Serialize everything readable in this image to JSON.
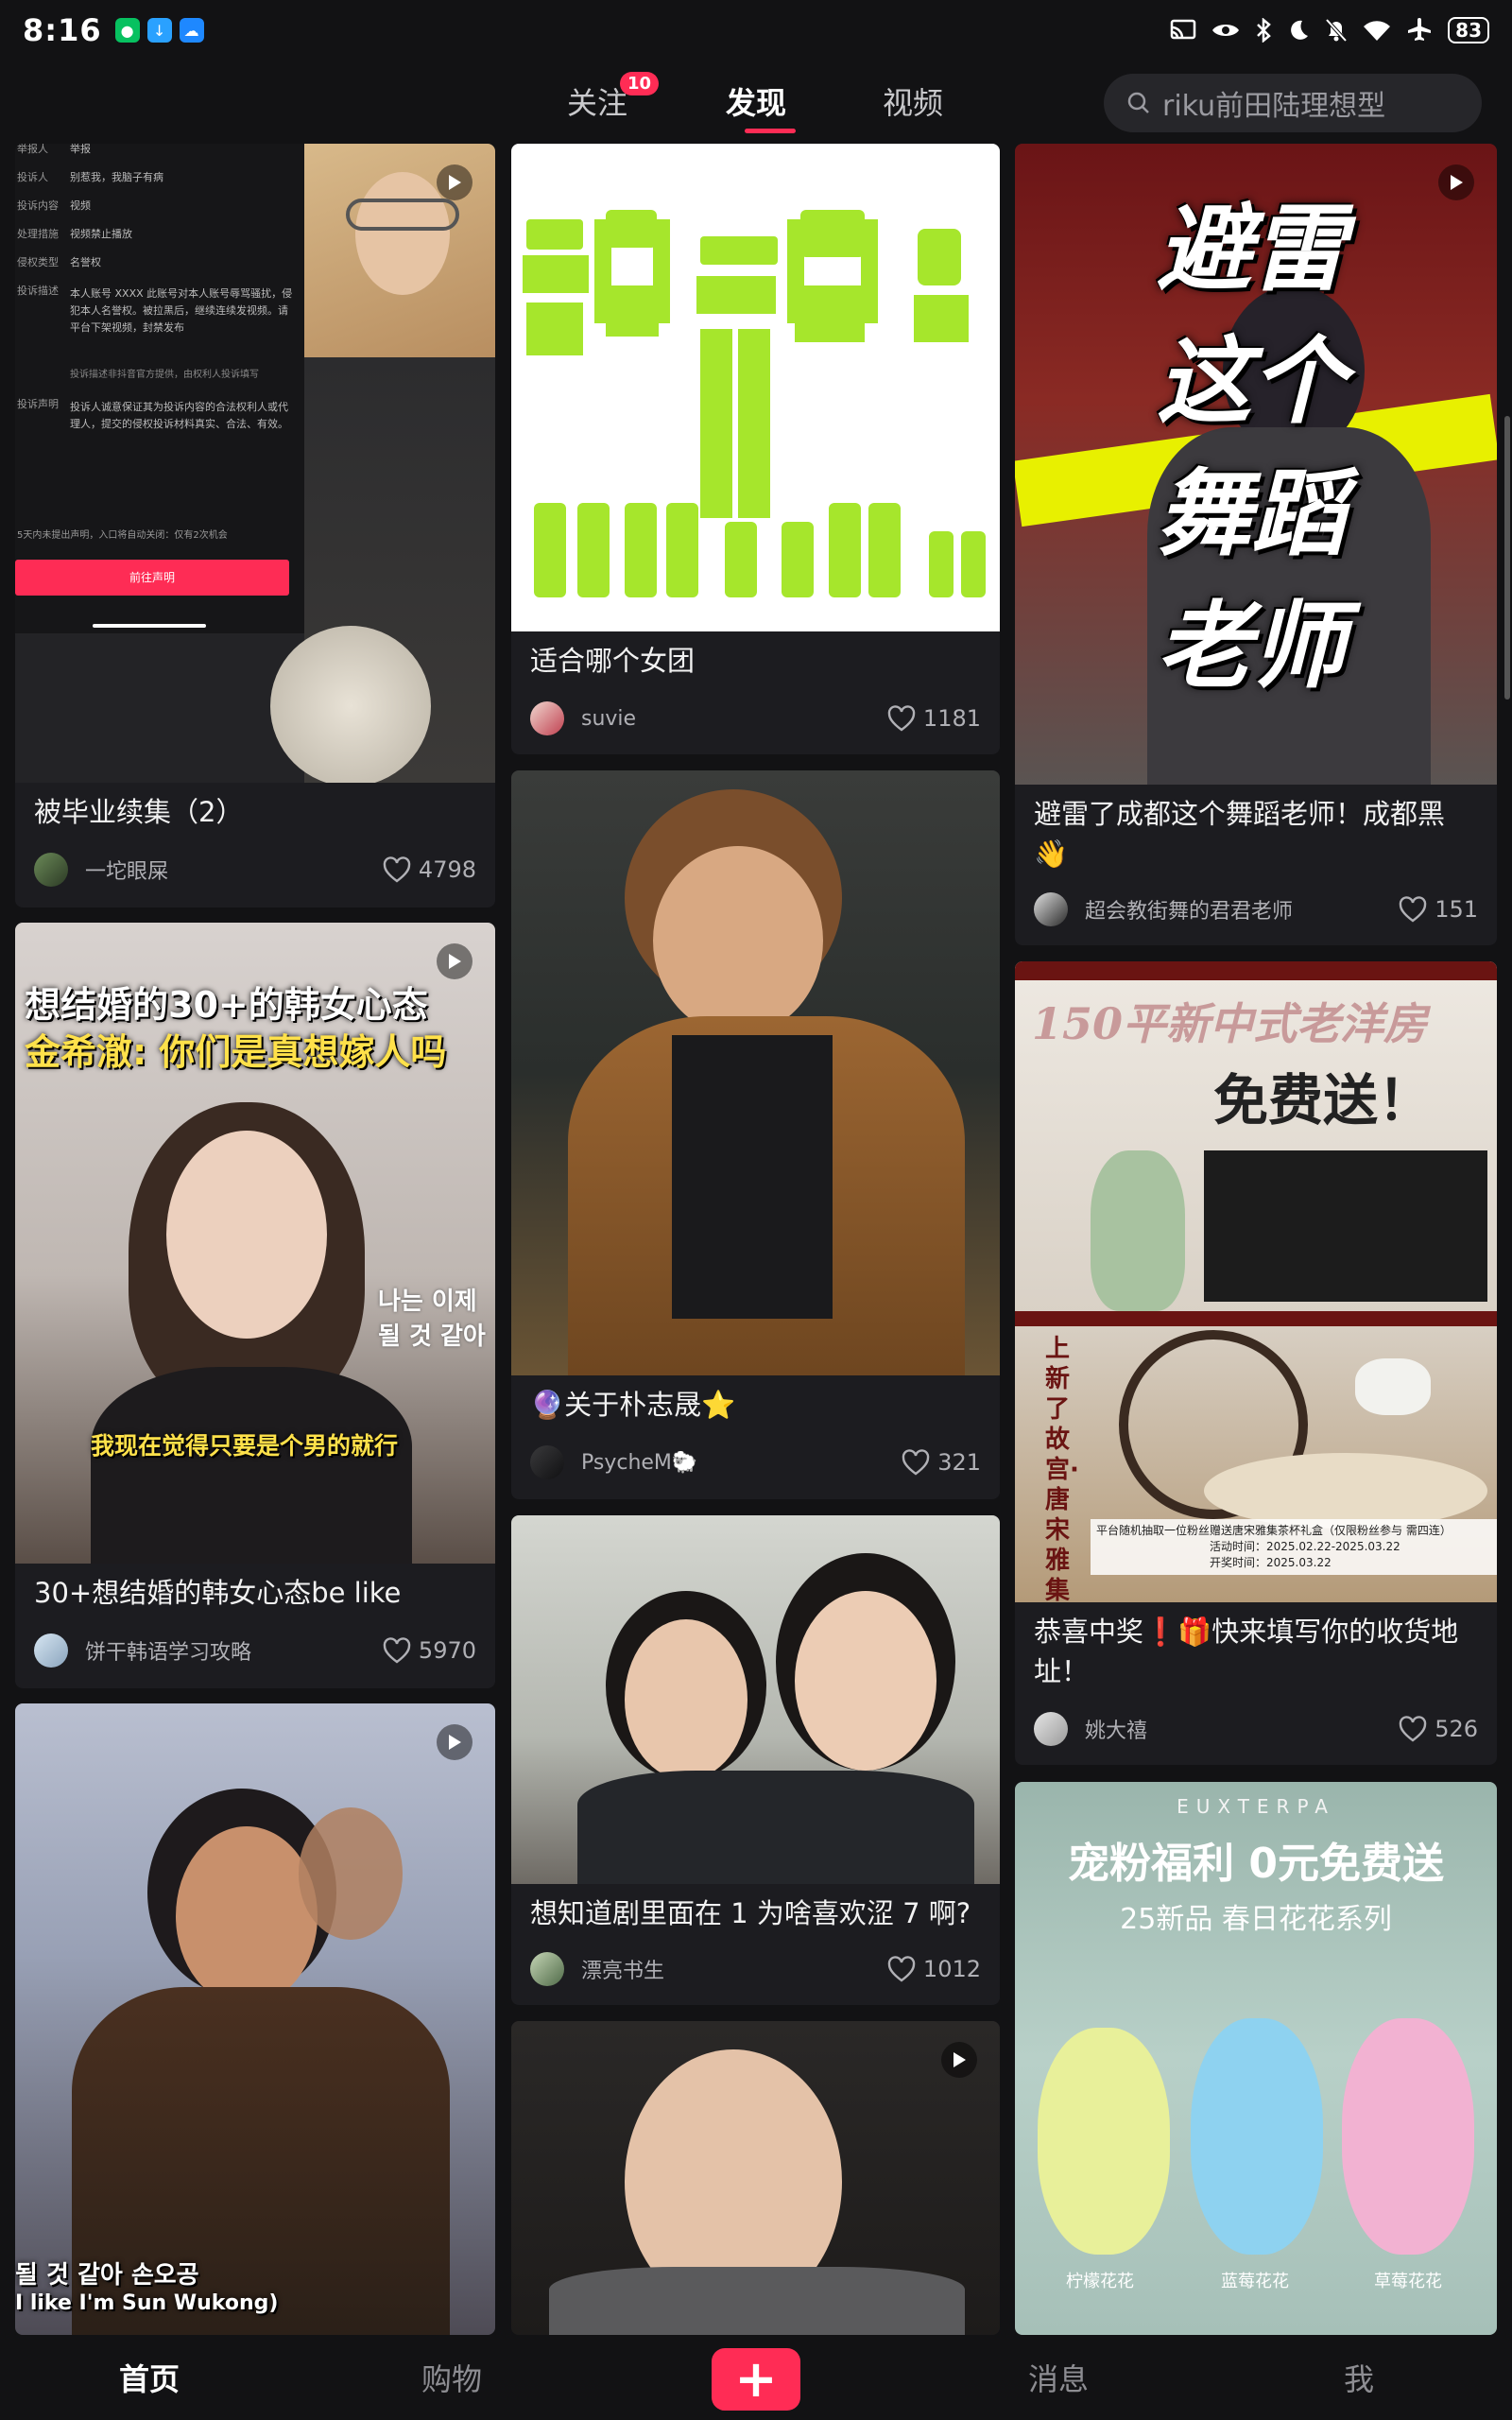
{
  "status_bar": {
    "time": "8:16",
    "battery": "83",
    "icons": [
      "cast-icon",
      "eye-icon",
      "bluetooth-icon",
      "moon-icon",
      "bell-off-icon",
      "wifi-icon",
      "airplane-icon"
    ]
  },
  "top_nav": {
    "tabs": [
      {
        "label": "关注",
        "badge": "10"
      },
      {
        "label": "发现"
      },
      {
        "label": "视频"
      }
    ],
    "active_tab": "发现",
    "search_placeholder": "riku前田陆理想型"
  },
  "feed": {
    "col1": [
      {
        "title": "被毕业续集（2）",
        "author": "一坨眼屎",
        "likes": "4798",
        "overlay": {
          "rows": [
            "举报",
            "别惹我，我脑子有病",
            "视频",
            "视频禁止播放",
            "名誉权"
          ],
          "row_labels": [
            "举报人",
            "投诉人",
            "投诉内容",
            "处理措施",
            "侵权类型"
          ],
          "desc_label": "投诉描述",
          "desc": "本人账号 XXXX 此账号对本人账号辱骂骚扰，侵犯本人名誉权。被拉黑后，继续连续发视频。请平台下架视频，封禁发布",
          "note": "投诉描述非抖音官方提供，由权利人投诉填写",
          "decl_label": "投诉声明",
          "decl": "投诉人诚意保证其为投诉内容的合法权利人或代理人，提交的侵权投诉材料真实、合法、有效。",
          "footer": "5天内未提出声明，入口将自动关闭：仅有2次机会",
          "button": "前往声明"
        }
      },
      {
        "title": "30+想结婚的韩女心态be like",
        "author": "饼干韩语学习攻略",
        "likes": "5970",
        "overlay": {
          "line1": "想结婚的30+的韩女心态",
          "line2": "金希澈: 你们是真想嫁人吗",
          "korean": "나는 이제\n될 것 같아",
          "subtitle": "我现在觉得只要是个男的就行"
        }
      },
      {
        "overlay": {
          "caption_kr": "될 것 같아 손오공",
          "caption_en": "I like I'm Sun Wukong)"
        }
      }
    ],
    "col2": [
      {
        "title": "适合哪个女团",
        "author": "suvie",
        "likes": "1181"
      },
      {
        "title": "🔮关于朴志晟⭐",
        "author": "PsycheM🐑",
        "likes": "321"
      },
      {
        "title": "想知道剧里面在 1 为啥喜欢涩 7 啊?",
        "author": "漂亮书生",
        "likes": "1012"
      },
      {}
    ],
    "col3": [
      {
        "title": "避雷了成都这个舞蹈老师！成都黑👋",
        "author": "超会教街舞的君君老师",
        "likes": "151",
        "overlay": {
          "lines": [
            "避雷",
            "这个",
            "舞蹈",
            "老师"
          ]
        }
      },
      {
        "title": "恭喜中奖❗🎁快来填写你的收货地址！",
        "author": "姚大禧",
        "likes": "526",
        "overlay": {
          "headline": "150平新中式老洋房",
          "sub": "免费送！",
          "vertical": "上新了故宫·唐宋雅集",
          "promo": "平台随机抽取一位粉丝赠送唐宋雅集茶杯礼盒（仅限粉丝参与 需四连）",
          "date1": "活动时间：2025.02.22-2025.03.22",
          "date2": "开奖时间：2025.03.22"
        }
      },
      {
        "overlay": {
          "brand": "EUXTERPA",
          "headline": "宠粉福利 0元免费送",
          "sub": "25新品 春日花花系列",
          "labels": [
            "柠檬花花",
            "蓝莓花花",
            "草莓花花"
          ]
        }
      }
    ]
  },
  "bottom_nav": {
    "items": [
      "首页",
      "购物",
      "消息",
      "我"
    ],
    "active": "首页",
    "plus": "+"
  },
  "colors": {
    "accent": "#ff2c55",
    "background": "#121214",
    "card": "#1c1c20"
  }
}
